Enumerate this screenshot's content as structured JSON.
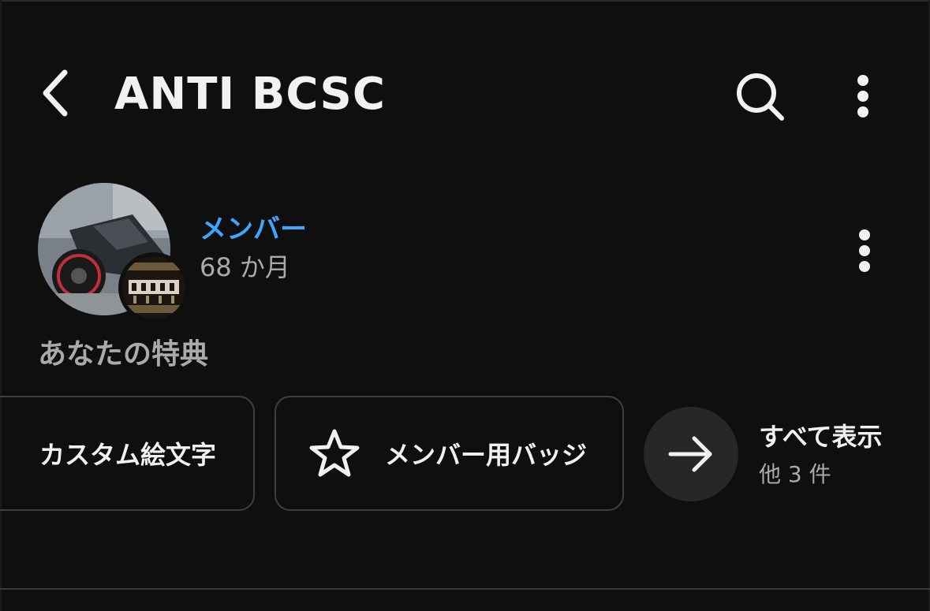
{
  "header": {
    "title": "ANTI BCSC",
    "back_icon": "chevron-left-icon",
    "search_icon": "search-icon",
    "more_icon": "more-vert-icon"
  },
  "member": {
    "label": "メンバー",
    "duration": "68 か月",
    "label_color": "#3ea6ff"
  },
  "perks": {
    "heading": "あなたの特典",
    "chips": [
      {
        "label": "カスタム絵文字"
      },
      {
        "label": "メンバー用バッジ",
        "icon": "star-outline-icon"
      }
    ],
    "show_all": {
      "label": "すべて表示",
      "sub": "他 3 件",
      "icon": "arrow-right-icon"
    }
  },
  "theme": {
    "background": "#0f0f0f",
    "text": "#f1f1f1",
    "secondary_text": "#aaaaaa",
    "border": "#3f3f3f"
  }
}
